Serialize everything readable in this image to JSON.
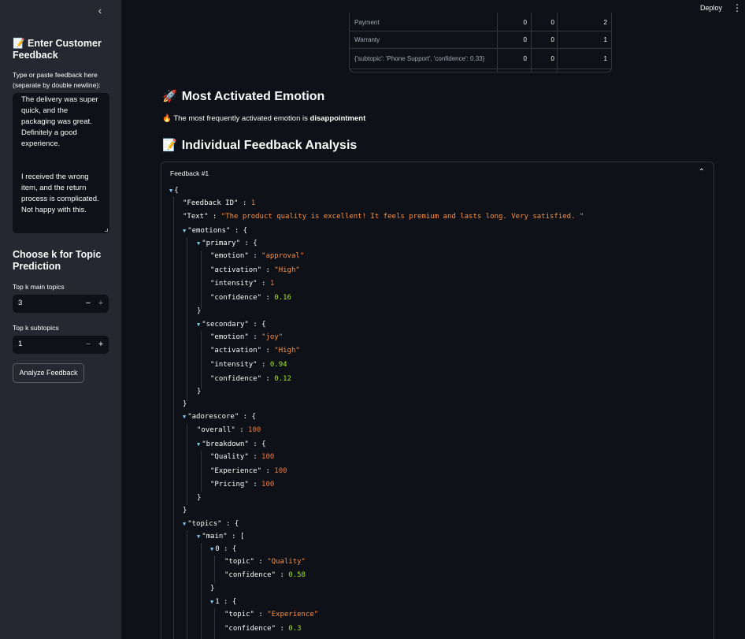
{
  "sidebar": {
    "collapse_icon": "‹",
    "title": "📝 Enter Customer Feedback",
    "textarea_label": "Type or paste feedback here (separate by double newline):",
    "textarea_value": "The delivery was super quick, and the packaging was great. Definitely a good experience.\n\n\nI received the wrong item, and the return process is complicated. Not happy with this.",
    "k_heading": "Choose k for Topic Prediction",
    "main_label": "Top k main topics",
    "main_value": "3",
    "sub_label": "Top k subtopics",
    "sub_value": "1",
    "minus": "−",
    "plus": "+",
    "analyze_label": "Analyze Feedback"
  },
  "header": {
    "deploy": "Deploy",
    "menu_icon": "⋮"
  },
  "topics_table": {
    "rows": [
      [
        "Payment",
        "0",
        "0",
        "2"
      ],
      [
        "Warranty",
        "0",
        "0",
        "1"
      ],
      [
        "{'subtopic': 'Phone Support', 'confidence': 0.33}",
        "0",
        "0",
        "1"
      ]
    ]
  },
  "emotion_section": {
    "icon": "🚀",
    "heading": "Most Activated Emotion",
    "fire_icon": "🔥",
    "text_prefix": "The most frequently activated emotion is ",
    "emotion": "disappointment"
  },
  "analysis_section": {
    "icon": "📝",
    "heading": "Individual Feedback Analysis",
    "expander_label": "Feedback #1",
    "chevron": "⌃"
  },
  "json_view": {
    "open_brace": "{",
    "feedback_id_key": "\"Feedback ID\"",
    "feedback_id": "1",
    "text_key": "\"Text\"",
    "text": "\"The product quality is excellent! It feels premium and lasts long. Very satisfied.  \"",
    "emotions_key": "\"emotions\"",
    "primary_key": "\"primary\"",
    "emotion_key": "\"emotion\"",
    "activation_key": "\"activation\"",
    "intensity_key": "\"intensity\"",
    "confidence_key": "\"confidence\"",
    "p_emotion": "\"approval\"",
    "p_activation": "\"High\"",
    "p_intensity": "1",
    "p_confidence": "0.16",
    "secondary_key": "\"secondary\"",
    "s_emotion": "\"joy\"",
    "s_activation": "\"High\"",
    "s_intensity": "0.94",
    "s_confidence": "0.12",
    "adorescore_key": "\"adorescore\"",
    "overall_key": "\"overall\"",
    "overall": "100",
    "breakdown_key": "\"breakdown\"",
    "quality_key": "\"Quality\"",
    "quality": "100",
    "experience_key": "\"Experience\"",
    "experience": "100",
    "pricing_key": "\"Pricing\"",
    "pricing": "100",
    "topics_key": "\"topics\"",
    "main_key": "\"main\"",
    "idx0": "0",
    "topic_key": "\"topic\"",
    "t0_topic": "\"Quality\"",
    "t0_conf": "0.58",
    "idx1": "1",
    "t1_topic": "\"Experience\"",
    "t1_conf": "0.3"
  }
}
